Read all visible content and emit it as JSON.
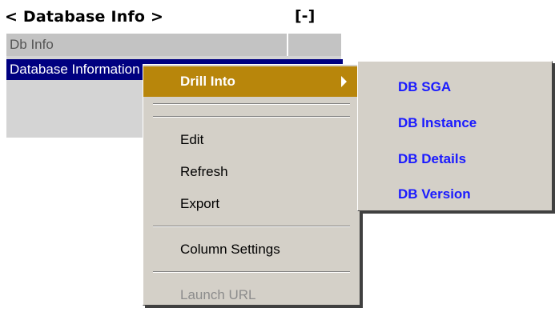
{
  "panel": {
    "title": "< Database Info >",
    "collapse_label": "[-]"
  },
  "list": {
    "header": "Db Info",
    "selected_row": "Database Information"
  },
  "context_menu": {
    "items": [
      {
        "label": "Drill Into",
        "state": "highlighted",
        "has_submenu": true
      },
      {
        "label": "Edit",
        "state": "enabled"
      },
      {
        "label": "Refresh",
        "state": "enabled"
      },
      {
        "label": "Export",
        "state": "enabled"
      },
      {
        "label": "Column Settings",
        "state": "enabled"
      },
      {
        "label": "Launch URL",
        "state": "disabled"
      }
    ],
    "highlight_color": "#b8860b"
  },
  "submenu": {
    "items": [
      "DB SGA",
      "DB Instance",
      "DB Details",
      "DB Version"
    ],
    "link_color": "#1a1aff"
  },
  "colors": {
    "selection": "#000080",
    "menu_bg": "#d4d0c8"
  }
}
